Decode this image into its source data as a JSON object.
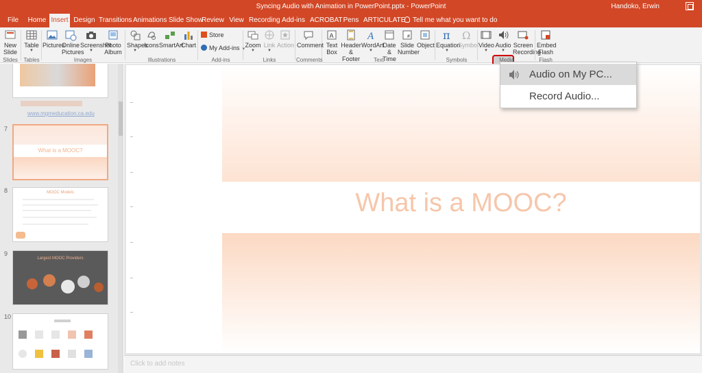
{
  "window": {
    "title": "Syncing Audio with Animation in PowerPoint.pptx  -  PowerPoint",
    "user": "Handoko, Erwin"
  },
  "tabs": [
    "File",
    "Home",
    "Insert",
    "Design",
    "Transitions",
    "Animations",
    "Slide Show",
    "Review",
    "View",
    "Recording",
    "Add-ins",
    "ACROBAT",
    "Pens",
    "ARTICULATE"
  ],
  "active_tab": "Insert",
  "tell_me": "Tell me what you want to do",
  "ribbon": {
    "new_slide": "New Slide",
    "table": "Table",
    "pictures": "Pictures",
    "online_pictures": "Online Pictures",
    "screenshot": "Screenshot",
    "photo_album": "Photo Album",
    "shapes": "Shapes",
    "icons": "Icons",
    "smartart": "SmartArt",
    "chart": "Chart",
    "store": "Store",
    "my_addins": "My Add-ins",
    "zoom": "Zoom",
    "link": "Link",
    "action": "Action",
    "comment": "Comment",
    "text_box": "Text Box",
    "header_footer": "Header & Footer",
    "wordart": "WordArt",
    "date_time": "Date & Time",
    "slide_number": "Slide Number",
    "object": "Object",
    "equation": "Equation",
    "symbol": "Symbol",
    "video": "Video",
    "audio": "Audio",
    "screen_recording": "Screen Recording",
    "embed_flash": "Embed Flash",
    "groups": [
      "Slides",
      "Tables",
      "Images",
      "Illustrations",
      "Add-ins",
      "Links",
      "Comments",
      "Text",
      "Symbols",
      "Media",
      "Flash"
    ]
  },
  "audio_menu": {
    "items": [
      "Audio on My PC...",
      "Record Audio..."
    ]
  },
  "slide_pane": {
    "thumbnails": [
      {
        "number": "",
        "link_text": "www.mgmeducation.ca.edu"
      },
      {
        "number": "7",
        "title": "What is a MOOC?"
      },
      {
        "number": "8",
        "title": "MOOC Models"
      },
      {
        "number": "9",
        "title": "Largest MOOC Providers"
      },
      {
        "number": "10",
        "title": ""
      }
    ]
  },
  "slide": {
    "title": "What is a MOOC?"
  },
  "notes_placeholder": "Click to add notes",
  "colors": {
    "accent": "#d24726",
    "highlight": "#d00000",
    "slide_title": "#f6c6aa"
  }
}
